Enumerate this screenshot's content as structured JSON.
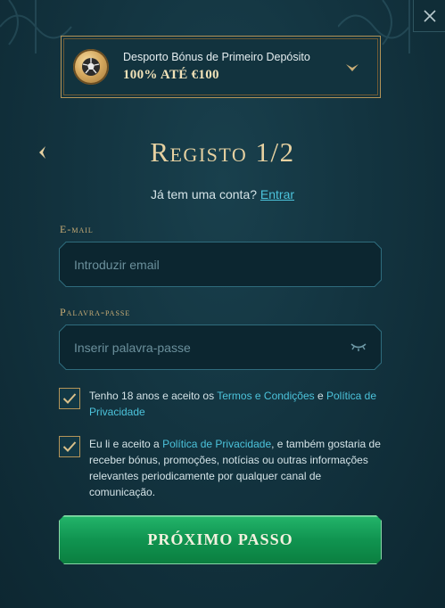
{
  "bonus": {
    "title": "Desporto Bónus de Primeiro Depósito",
    "amount": "100% ATÉ €100"
  },
  "heading": {
    "title": "Registo 1/2"
  },
  "login": {
    "prompt": "Já tem uma conta?",
    "link": "Entrar"
  },
  "email": {
    "label": "E-mail",
    "placeholder": "Introduzir email"
  },
  "password": {
    "label": "Palavra-passe",
    "placeholder": "Inserir palavra-passe"
  },
  "consent_terms": {
    "checked": true,
    "text_before": "Tenho 18 anos e aceito os ",
    "link_terms": "Termos e Condições",
    "text_and": " e ",
    "link_privacy": "Política de Privacidade"
  },
  "consent_marketing": {
    "checked": true,
    "text_before": "Eu li e aceito a ",
    "link_privacy": "Política de Privacidade",
    "text_after": ", e também gostaria de receber bónus, promoções, notícias ou outras informações relevantes periodicamente por qualquer canal de comunicação."
  },
  "next_button": {
    "label": "PRÓXIMO PASSO"
  },
  "colors": {
    "gold": "#c9ad76",
    "link": "#4cc3db",
    "button_green": "#109450",
    "background": "#133440"
  }
}
